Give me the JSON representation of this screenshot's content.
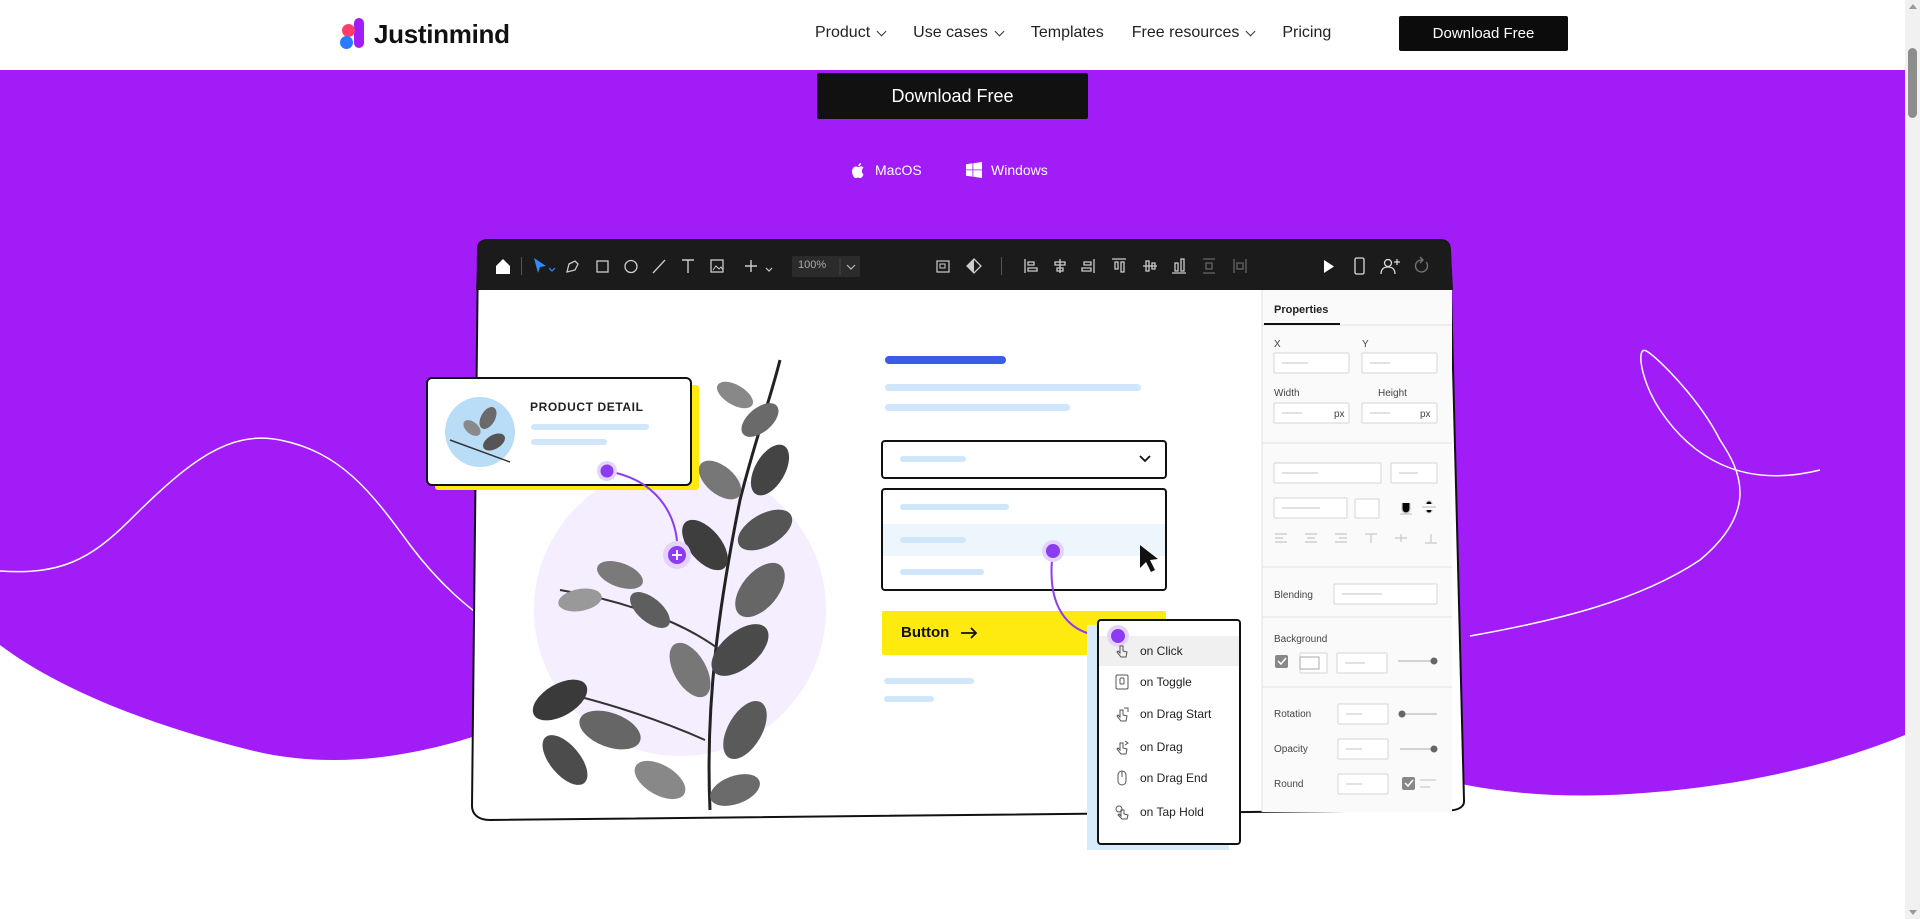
{
  "header": {
    "logo_text": "Justinmind",
    "nav": [
      {
        "label": "Product",
        "dropdown": true
      },
      {
        "label": "Use cases",
        "dropdown": true
      },
      {
        "label": "Templates",
        "dropdown": false
      },
      {
        "label": "Free resources",
        "dropdown": true
      },
      {
        "label": "Pricing",
        "dropdown": false
      }
    ],
    "cta_label": "Download Free"
  },
  "hero": {
    "cta_label": "Download Free",
    "platforms": [
      {
        "label": "MacOS",
        "icon": "apple-icon"
      },
      {
        "label": "Windows",
        "icon": "windows-icon"
      }
    ],
    "background_color": "#a11cf7"
  },
  "mockup": {
    "zoom": "100%",
    "product_card_title": "PRODUCT DETAIL",
    "button_label": "Button",
    "events": [
      {
        "label": "on Click",
        "icon": "pointer-click-icon"
      },
      {
        "label": "on Toggle",
        "icon": "toggle-icon"
      },
      {
        "label": "on Drag Start",
        "icon": "drag-start-icon"
      },
      {
        "label": "on Drag",
        "icon": "drag-icon"
      },
      {
        "label": "on Drag End",
        "icon": "drag-end-icon"
      },
      {
        "label": "on Tap Hold",
        "icon": "tap-hold-icon"
      }
    ],
    "properties": {
      "title": "Properties",
      "x_label": "X",
      "y_label": "Y",
      "width_label": "Width",
      "height_label": "Height",
      "unit": "px",
      "blending_label": "Blending",
      "background_label": "Background",
      "rotation_label": "Rotation",
      "opacity_label": "Opacity",
      "round_label": "Round"
    }
  }
}
